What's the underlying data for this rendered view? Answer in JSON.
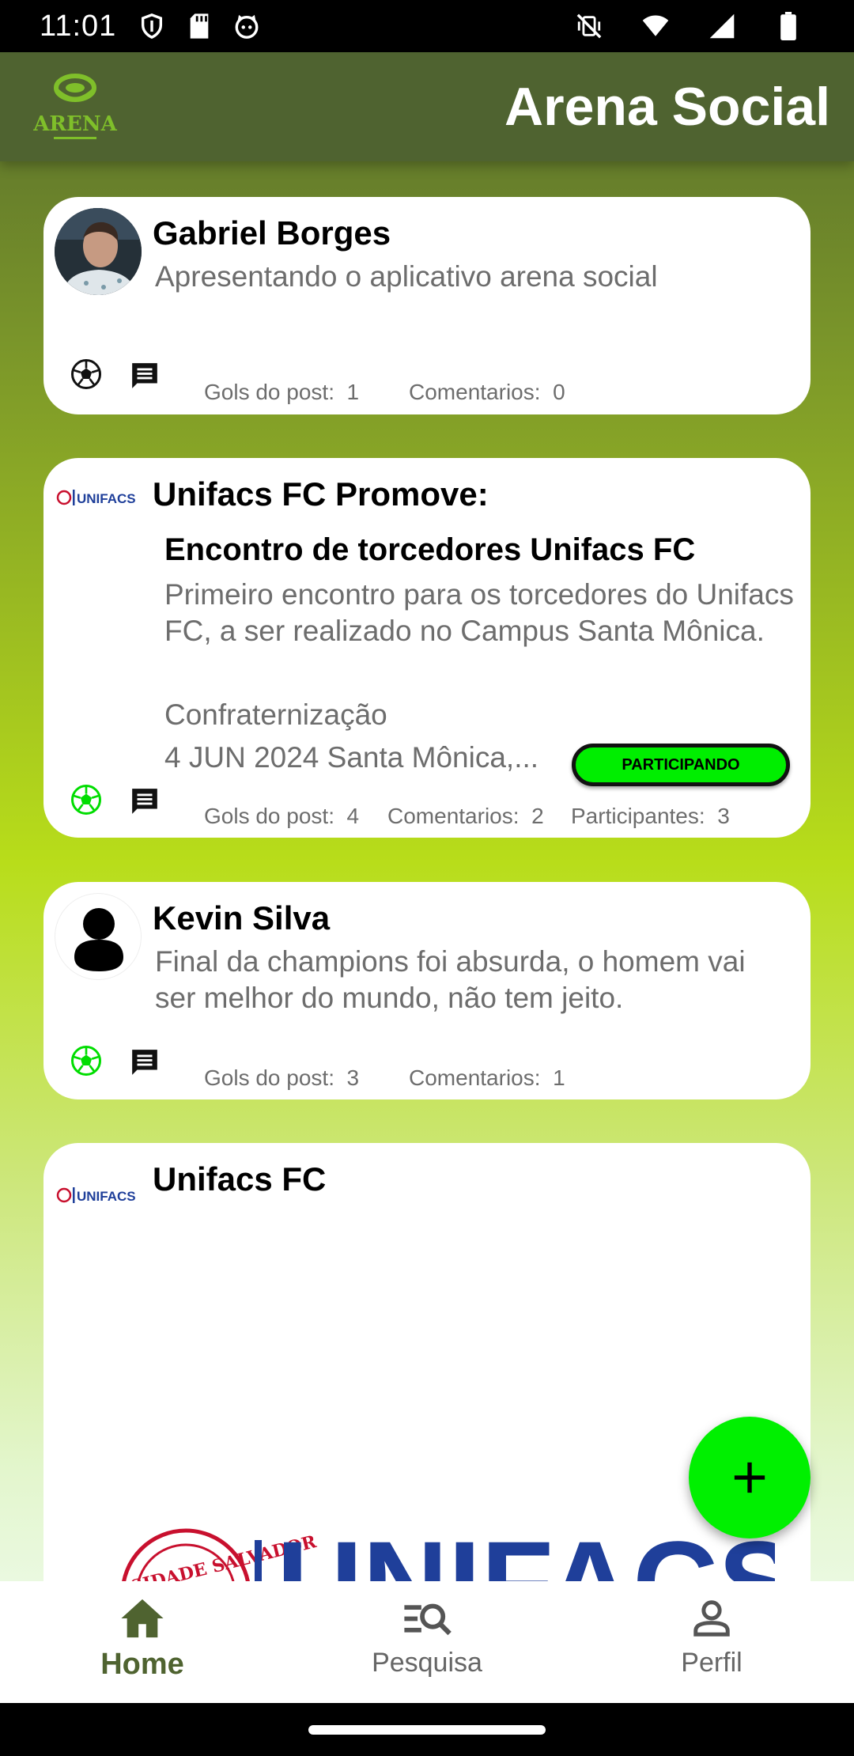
{
  "status_bar": {
    "time": "11:01"
  },
  "app_bar": {
    "title": "Arena Social",
    "logo_text": "ARENA"
  },
  "posts": [
    {
      "author": "Gabriel Borges",
      "text": "Apresentando o aplicativo arena social",
      "goals_label": "Gols do post:",
      "goals": "1",
      "comments_label": "Comentarios:",
      "comments": "0"
    },
    {
      "author": "Unifacs FC Promove:",
      "logo_text": "UNIFACS",
      "event_title": "Encontro de torcedores Unifacs FC",
      "event_description": "Primeiro encontro para os torcedores do Unifacs FC, a ser realizado no Campus Santa Mônica.",
      "event_category": "Confraternização",
      "event_date": "4 JUN 2024",
      "event_location": "Santa Mônica,...",
      "participate_label": "PARTICIPANDO",
      "goals_label": "Gols do post:",
      "goals": "4",
      "comments_label": "Comentarios:",
      "comments": "2",
      "participants_label": "Participantes:",
      "participants": "3"
    },
    {
      "author": "Kevin Silva",
      "text": "Final da champions foi absurda, o homem vai ser melhor do mundo, não tem jeito.",
      "goals_label": "Gols do post:",
      "goals": "3",
      "comments_label": "Comentarios:",
      "comments": "1"
    },
    {
      "author": "Unifacs FC",
      "logo_text": "UNIFACS",
      "image_text": "UNIFACS",
      "seal_text": "UNIVERSIDADE SALVADOR"
    }
  ],
  "bottom_nav": [
    {
      "label": "Home",
      "icon": "home-icon",
      "active": true
    },
    {
      "label": "Pesquisa",
      "icon": "search-list-icon",
      "active": false
    },
    {
      "label": "Perfil",
      "icon": "person-icon",
      "active": false
    }
  ],
  "colors": {
    "app_bar": "#4f6330",
    "accent_green": "#00f000",
    "active_nav": "#4f6330",
    "unifacs_blue": "#1f3f9a",
    "unifacs_red": "#c8102e"
  }
}
